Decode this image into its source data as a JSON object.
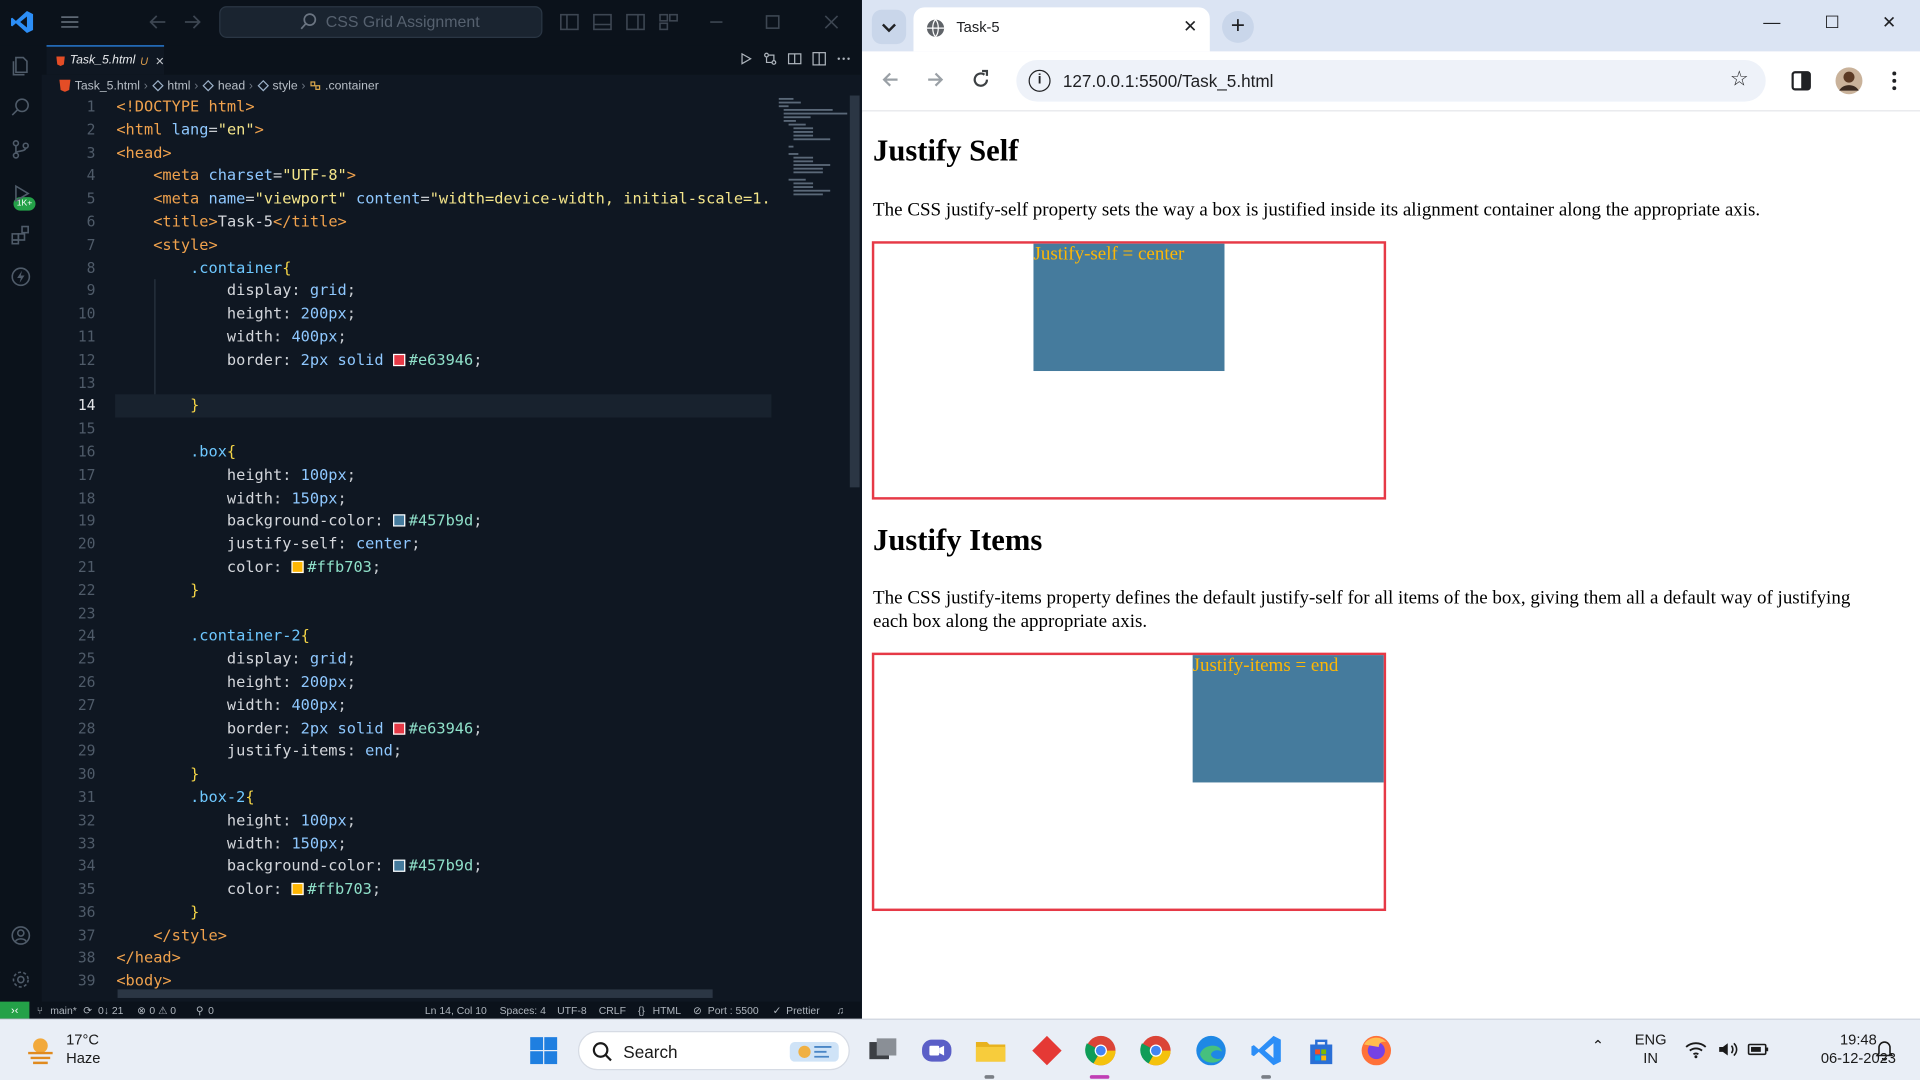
{
  "vscode": {
    "command_center": "CSS Grid Assignment",
    "tab": {
      "filename": "Task_5.html",
      "flag": "U"
    },
    "breadcrumb": [
      "Task_5.html",
      "html",
      "head",
      "style",
      ".container"
    ],
    "lines": [
      [
        [
          "t-br",
          "<!DOCTYPE "
        ],
        [
          "t-tag",
          "html"
        ],
        [
          "t-br",
          ">"
        ]
      ],
      [
        [
          "t-br",
          "<"
        ],
        [
          "t-tag",
          "html"
        ],
        [
          "t-attr",
          " lang"
        ],
        [
          "t-punc",
          "="
        ],
        [
          "t-str",
          "\"en\""
        ],
        [
          "t-br",
          ">"
        ]
      ],
      [
        [
          "t-br",
          "<"
        ],
        [
          "t-tag",
          "head"
        ],
        [
          "t-br",
          ">"
        ]
      ],
      [
        [
          "t-text",
          "    "
        ],
        [
          "t-br",
          "<"
        ],
        [
          "t-tag",
          "meta"
        ],
        [
          "t-attr",
          " charset"
        ],
        [
          "t-punc",
          "="
        ],
        [
          "t-str",
          "\"UTF-8\""
        ],
        [
          "t-br",
          ">"
        ]
      ],
      [
        [
          "t-text",
          "    "
        ],
        [
          "t-br",
          "<"
        ],
        [
          "t-tag",
          "meta"
        ],
        [
          "t-attr",
          " name"
        ],
        [
          "t-punc",
          "="
        ],
        [
          "t-str",
          "\"viewport\""
        ],
        [
          "t-attr",
          " content"
        ],
        [
          "t-punc",
          "="
        ],
        [
          "t-str",
          "\"width=device-width, initial-scale=1."
        ]
      ],
      [
        [
          "t-text",
          "    "
        ],
        [
          "t-br",
          "<"
        ],
        [
          "t-tag",
          "title"
        ],
        [
          "t-br",
          ">"
        ],
        [
          "t-text",
          "Task-5"
        ],
        [
          "t-br",
          "</"
        ],
        [
          "t-tag",
          "title"
        ],
        [
          "t-br",
          ">"
        ]
      ],
      [
        [
          "t-text",
          "    "
        ],
        [
          "t-br",
          "<"
        ],
        [
          "t-tag",
          "style"
        ],
        [
          "t-br",
          ">"
        ]
      ],
      [
        [
          "t-text",
          "        "
        ],
        [
          "t-sel",
          ".container"
        ],
        [
          "t-brace",
          "{"
        ]
      ],
      [
        [
          "t-text",
          "            "
        ],
        [
          "t-prop",
          "display"
        ],
        [
          "t-punc",
          ": "
        ],
        [
          "t-val",
          "grid"
        ],
        [
          "t-punc",
          ";"
        ]
      ],
      [
        [
          "t-text",
          "            "
        ],
        [
          "t-prop",
          "height"
        ],
        [
          "t-punc",
          ": "
        ],
        [
          "t-num",
          "200px"
        ],
        [
          "t-punc",
          ";"
        ]
      ],
      [
        [
          "t-text",
          "            "
        ],
        [
          "t-prop",
          "width"
        ],
        [
          "t-punc",
          ": "
        ],
        [
          "t-num",
          "400px"
        ],
        [
          "t-punc",
          ";"
        ]
      ],
      [
        [
          "t-text",
          "            "
        ],
        [
          "t-prop",
          "border"
        ],
        [
          "t-punc",
          ": "
        ],
        [
          "t-num",
          "2px"
        ],
        [
          "t-val",
          " solid "
        ],
        [
          "sw",
          "#e63946"
        ],
        [
          "t-hex",
          "#e63946"
        ],
        [
          "t-punc",
          ";"
        ]
      ],
      [],
      [
        [
          "t-text",
          "        "
        ],
        [
          "t-brace",
          "}"
        ]
      ],
      [],
      [
        [
          "t-text",
          "        "
        ],
        [
          "t-sel",
          ".box"
        ],
        [
          "t-brace",
          "{"
        ]
      ],
      [
        [
          "t-text",
          "            "
        ],
        [
          "t-prop",
          "height"
        ],
        [
          "t-punc",
          ": "
        ],
        [
          "t-num",
          "100px"
        ],
        [
          "t-punc",
          ";"
        ]
      ],
      [
        [
          "t-text",
          "            "
        ],
        [
          "t-prop",
          "width"
        ],
        [
          "t-punc",
          ": "
        ],
        [
          "t-num",
          "150px"
        ],
        [
          "t-punc",
          ";"
        ]
      ],
      [
        [
          "t-text",
          "            "
        ],
        [
          "t-prop",
          "background-color"
        ],
        [
          "t-punc",
          ": "
        ],
        [
          "sw",
          "#457b9d"
        ],
        [
          "t-hex",
          "#457b9d"
        ],
        [
          "t-punc",
          ";"
        ]
      ],
      [
        [
          "t-text",
          "            "
        ],
        [
          "t-prop",
          "justify-self"
        ],
        [
          "t-punc",
          ": "
        ],
        [
          "t-val",
          "center"
        ],
        [
          "t-punc",
          ";"
        ]
      ],
      [
        [
          "t-text",
          "            "
        ],
        [
          "t-prop",
          "color"
        ],
        [
          "t-punc",
          ": "
        ],
        [
          "sw",
          "#ffb703"
        ],
        [
          "t-hex",
          "#ffb703"
        ],
        [
          "t-punc",
          ";"
        ]
      ],
      [
        [
          "t-text",
          "        "
        ],
        [
          "t-brace",
          "}"
        ]
      ],
      [],
      [
        [
          "t-text",
          "        "
        ],
        [
          "t-sel",
          ".container-2"
        ],
        [
          "t-brace",
          "{"
        ]
      ],
      [
        [
          "t-text",
          "            "
        ],
        [
          "t-prop",
          "display"
        ],
        [
          "t-punc",
          ": "
        ],
        [
          "t-val",
          "grid"
        ],
        [
          "t-punc",
          ";"
        ]
      ],
      [
        [
          "t-text",
          "            "
        ],
        [
          "t-prop",
          "height"
        ],
        [
          "t-punc",
          ": "
        ],
        [
          "t-num",
          "200px"
        ],
        [
          "t-punc",
          ";"
        ]
      ],
      [
        [
          "t-text",
          "            "
        ],
        [
          "t-prop",
          "width"
        ],
        [
          "t-punc",
          ": "
        ],
        [
          "t-num",
          "400px"
        ],
        [
          "t-punc",
          ";"
        ]
      ],
      [
        [
          "t-text",
          "            "
        ],
        [
          "t-prop",
          "border"
        ],
        [
          "t-punc",
          ": "
        ],
        [
          "t-num",
          "2px"
        ],
        [
          "t-val",
          " solid "
        ],
        [
          "sw",
          "#e63946"
        ],
        [
          "t-hex",
          "#e63946"
        ],
        [
          "t-punc",
          ";"
        ]
      ],
      [
        [
          "t-text",
          "            "
        ],
        [
          "t-prop",
          "justify-items"
        ],
        [
          "t-punc",
          ": "
        ],
        [
          "t-val",
          "end"
        ],
        [
          "t-punc",
          ";"
        ]
      ],
      [
        [
          "t-text",
          "        "
        ],
        [
          "t-brace",
          "}"
        ]
      ],
      [
        [
          "t-text",
          "        "
        ],
        [
          "t-sel",
          ".box-2"
        ],
        [
          "t-brace",
          "{"
        ]
      ],
      [
        [
          "t-text",
          "            "
        ],
        [
          "t-prop",
          "height"
        ],
        [
          "t-punc",
          ": "
        ],
        [
          "t-num",
          "100px"
        ],
        [
          "t-punc",
          ";"
        ]
      ],
      [
        [
          "t-text",
          "            "
        ],
        [
          "t-prop",
          "width"
        ],
        [
          "t-punc",
          ": "
        ],
        [
          "t-num",
          "150px"
        ],
        [
          "t-punc",
          ";"
        ]
      ],
      [
        [
          "t-text",
          "            "
        ],
        [
          "t-prop",
          "background-color"
        ],
        [
          "t-punc",
          ": "
        ],
        [
          "sw",
          "#457b9d"
        ],
        [
          "t-hex",
          "#457b9d"
        ],
        [
          "t-punc",
          ";"
        ]
      ],
      [
        [
          "t-text",
          "            "
        ],
        [
          "t-prop",
          "color"
        ],
        [
          "t-punc",
          ": "
        ],
        [
          "sw",
          "#ffb703"
        ],
        [
          "t-hex",
          "#ffb703"
        ],
        [
          "t-punc",
          ";"
        ]
      ],
      [
        [
          "t-text",
          "        "
        ],
        [
          "t-brace",
          "}"
        ]
      ],
      [
        [
          "t-text",
          "    "
        ],
        [
          "t-br",
          "</"
        ],
        [
          "t-tag",
          "style"
        ],
        [
          "t-br",
          ">"
        ]
      ],
      [
        [
          "t-br",
          "</"
        ],
        [
          "t-tag",
          "head"
        ],
        [
          "t-br",
          ">"
        ]
      ],
      [
        [
          "t-br",
          "<"
        ],
        [
          "t-tag",
          "body"
        ],
        [
          "t-br",
          ">"
        ]
      ]
    ],
    "active_line": 14,
    "status": {
      "branch": "main*",
      "sync": "0↓ 21",
      "problems": "0 ⚠ 0",
      "ports": "0",
      "position": "Ln 14, Col 10",
      "spaces": "Spaces: 4",
      "encoding": "UTF-8",
      "eol": "CRLF",
      "language": "HTML",
      "port": "Port : 5500",
      "formatter": "Prettier"
    },
    "badge": "1K+"
  },
  "browser": {
    "tab_title": "Task-5",
    "url": "127.0.0.1:5500/Task_5.html",
    "page": {
      "heading1": "Justify Self",
      "para1": "The CSS justify-self property sets the way a box is justified inside its alignment container along the appropriate axis.",
      "box1_text": "Justify-self = center",
      "heading2": "Justify Items",
      "para2": "The CSS justify-items property defines the default justify-self for all items of the box, giving them all a default way of justifying each box along the appropriate axis.",
      "box2_text": "Justify-items = end"
    },
    "colors": {
      "border": "#e63946",
      "box": "#457b9d",
      "box_text": "#ffb703"
    }
  },
  "taskbar": {
    "weather_temp": "17°C",
    "weather_desc": "Haze",
    "search_label": "Search",
    "lang_top": "ENG",
    "lang_bottom": "IN",
    "time": "19:48",
    "date": "06-12-2023"
  }
}
